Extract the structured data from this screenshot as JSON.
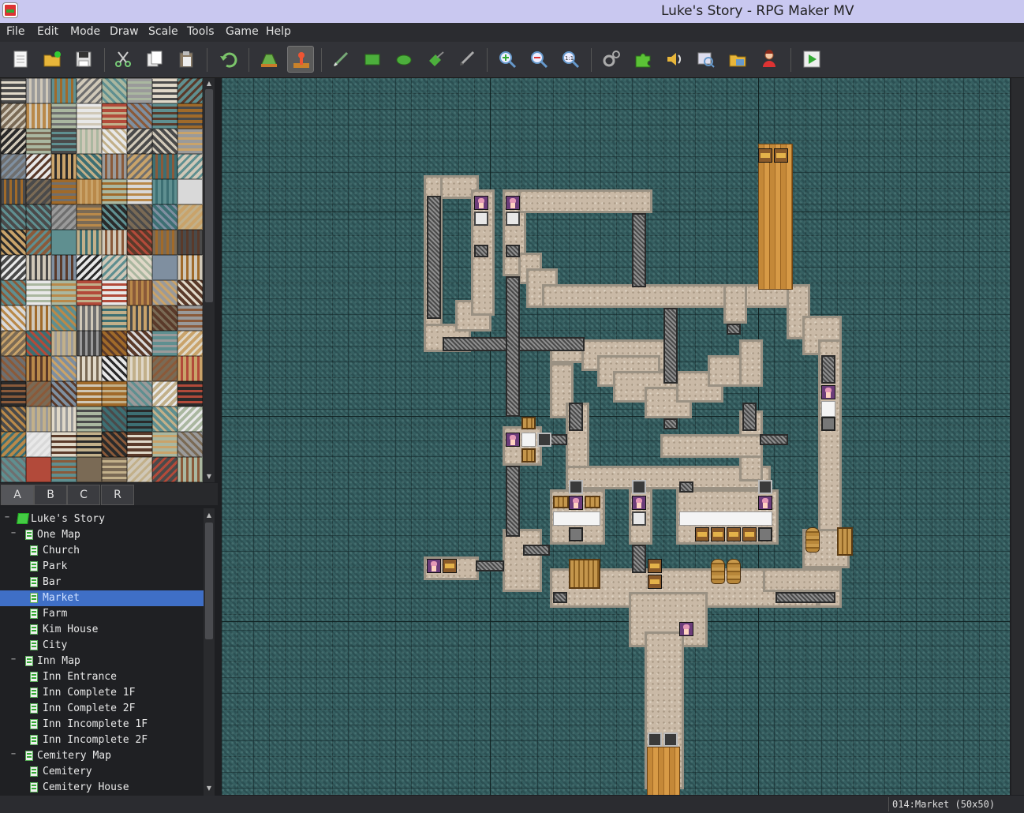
{
  "window": {
    "title": "Luke's Story - RPG Maker MV"
  },
  "menu": [
    "File",
    "Edit",
    "Mode",
    "Draw",
    "Scale",
    "Tools",
    "Game",
    "Help"
  ],
  "toolbar": {
    "buttons": [
      "new-project",
      "open-project",
      "save-project",
      "cut",
      "copy",
      "paste",
      "undo",
      "map-mode",
      "event-mode",
      "pencil",
      "rectangle",
      "ellipse",
      "flood-fill",
      "shadow-pen",
      "zoom-in",
      "zoom-out",
      "actual-size",
      "database",
      "plugin-manager",
      "sound-test",
      "event-searcher",
      "resource-manager",
      "character-generator",
      "playtest"
    ],
    "active": "event-mode"
  },
  "tileset_tabs": [
    "A",
    "B",
    "C",
    "R"
  ],
  "active_tileset_tab": "A",
  "map_tree": [
    {
      "label": "Luke's Story",
      "level": 0,
      "type": "root",
      "toggle": "−"
    },
    {
      "label": "One Map",
      "level": 1,
      "type": "map",
      "toggle": "−"
    },
    {
      "label": "Church",
      "level": 2,
      "type": "map"
    },
    {
      "label": "Park",
      "level": 2,
      "type": "map"
    },
    {
      "label": "Bar",
      "level": 2,
      "type": "map"
    },
    {
      "label": "Market",
      "level": 2,
      "type": "map",
      "selected": true
    },
    {
      "label": "Farm",
      "level": 2,
      "type": "map"
    },
    {
      "label": "Kim House",
      "level": 2,
      "type": "map"
    },
    {
      "label": "City",
      "level": 2,
      "type": "map"
    },
    {
      "label": "Inn Map",
      "level": 1,
      "type": "map",
      "toggle": "−"
    },
    {
      "label": "Inn Entrance",
      "level": 2,
      "type": "map"
    },
    {
      "label": "Inn Complete 1F",
      "level": 2,
      "type": "map"
    },
    {
      "label": "Inn Complete 2F",
      "level": 2,
      "type": "map"
    },
    {
      "label": "Inn Incomplete 1F",
      "level": 2,
      "type": "map"
    },
    {
      "label": "Inn Incomplete 2F",
      "level": 2,
      "type": "map"
    },
    {
      "label": "Cemitery Map",
      "level": 1,
      "type": "map",
      "toggle": "−"
    },
    {
      "label": "Cemitery",
      "level": 2,
      "type": "map"
    },
    {
      "label": "Cemitery House",
      "level": 2,
      "type": "map"
    }
  ],
  "status": {
    "map_info": "014:Market (50x50)"
  },
  "colors": {
    "selected_row": "#3f6fc6",
    "water": "#2f5457",
    "floor": "#c9b9a6"
  }
}
